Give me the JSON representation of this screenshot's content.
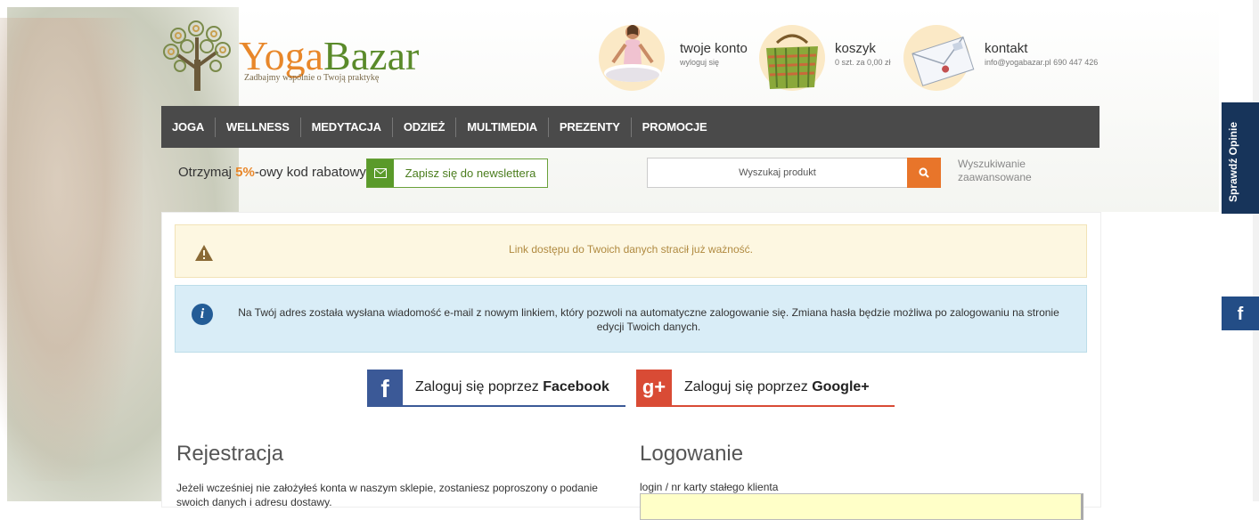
{
  "logo": {
    "brand_part1": "Yoga",
    "brand_part2": "Bazar",
    "tagline": "Zadbajmy wspólnie o Twoją praktykę"
  },
  "header": {
    "account": {
      "title": "twoje konto",
      "sub": "wyloguj się"
    },
    "cart": {
      "title": "koszyk",
      "sub": "0 szt. za 0,00 zł"
    },
    "contact": {
      "title": "kontakt",
      "sub": "info@yogabazar.pl  690 447 426"
    }
  },
  "nav": [
    "JOGA",
    "WELLNESS",
    "MEDYTACJA",
    "ODZIEŻ",
    "MULTIMEDIA",
    "PREZENTY",
    "PROMOCJE"
  ],
  "promo": {
    "prefix": "Otrzymaj ",
    "highlight": "5%",
    "suffix": "-owy kod rabatowy",
    "newsletter_label": "Zapisz się do newslettera"
  },
  "search": {
    "placeholder": "Wyszukaj produkt",
    "advanced_label": "Wyszukiwanie zaawansowane"
  },
  "alerts": {
    "warning": "Link dostępu do Twoich danych stracił już ważność.",
    "info": "Na Twój adres została wysłana wiadomość e-mail z nowym linkiem, który pozwoli na automatyczne zalogowanie się. Zmiana hasła będzie możliwa po zalogowaniu na stronie edycji Twoich danych."
  },
  "social": {
    "facebook_prefix": "Zaloguj się poprzez ",
    "facebook_bold": "Facebook",
    "google_prefix": "Zaloguj się poprzez ",
    "google_bold": "Google+"
  },
  "register": {
    "heading": "Rejestracja",
    "text": "Jeżeli wcześniej nie założyłeś konta w naszym sklepie, zostaniesz poproszony o podanie swoich danych i adresu dostawy."
  },
  "login": {
    "heading": "Logowanie",
    "login_label": "login / nr karty stałego klienta"
  },
  "side": {
    "opinie": "Sprawdź Opinie",
    "fb": "f"
  },
  "colors": {
    "nav_bg": "#4a4a4a",
    "accent_orange": "#e8752a",
    "accent_green": "#5a9a2a",
    "facebook": "#3b5997",
    "google": "#d94b35"
  }
}
